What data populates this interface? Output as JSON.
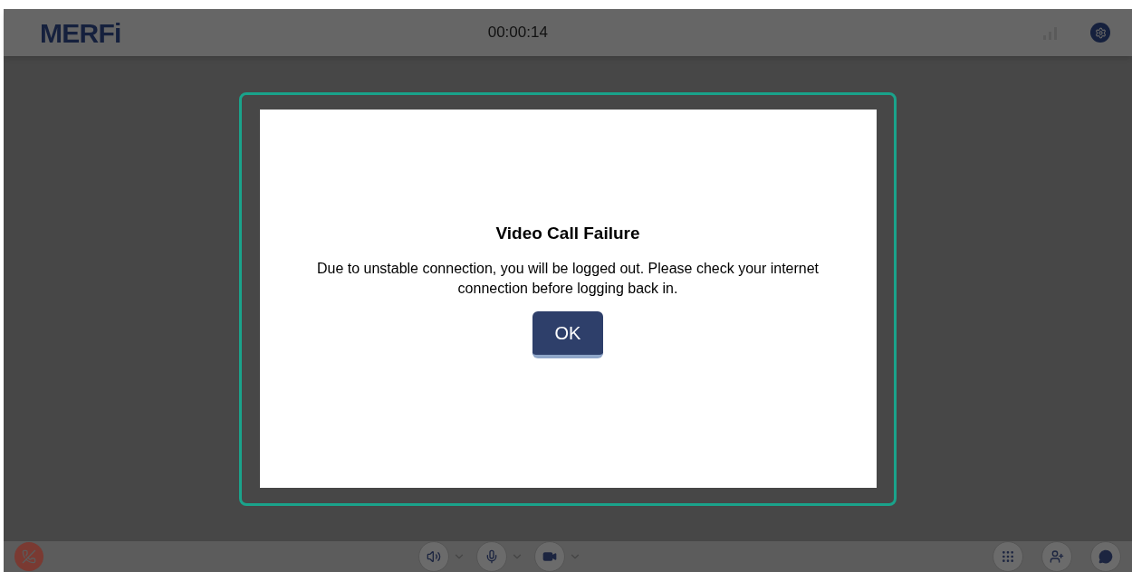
{
  "header": {
    "logo": "MERFi",
    "timer": "00:00:14"
  },
  "dialog": {
    "title": "Video Call Failure",
    "message": "Due to unstable connection, you will be logged out. Please check your internet connection before logging back in.",
    "button": "OK"
  }
}
